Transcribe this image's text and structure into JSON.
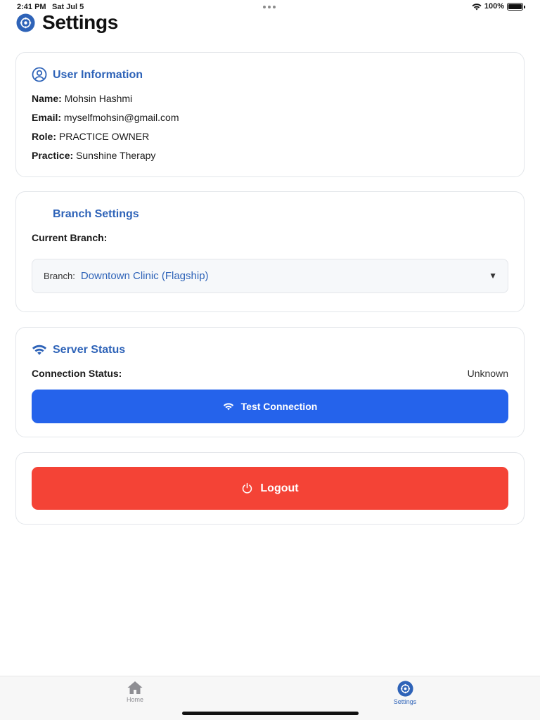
{
  "status_bar": {
    "time": "2:41 PM",
    "date": "Sat Jul 5",
    "battery": "100%",
    "icons": [
      "wifi-icon",
      "battery-icon"
    ]
  },
  "header": {
    "title": "Settings",
    "icon": "settings-icon"
  },
  "user_info": {
    "title": "User Information",
    "icon": "user-circle-icon",
    "fields": [
      {
        "label": "Name:",
        "value": "Mohsin Hashmi"
      },
      {
        "label": "Email:",
        "value": "myselfmohsin@gmail.com"
      },
      {
        "label": "Role:",
        "value": "PRACTICE OWNER"
      },
      {
        "label": "Practice:",
        "value": "Sunshine Therapy"
      }
    ]
  },
  "branch_settings": {
    "title": "Branch Settings",
    "current_label": "Current Branch:",
    "select": {
      "label": "Branch:",
      "value": "Downtown Clinic (Flagship)",
      "caret": "▼"
    }
  },
  "server_status": {
    "title": "Server Status",
    "icon": "wifi-icon",
    "connection_label": "Connection Status:",
    "connection_value": "Unknown",
    "test_button": "Test Connection"
  },
  "logout": {
    "button": "Logout",
    "icon": "power-icon"
  },
  "tab_bar": {
    "tabs": [
      {
        "label": "Home",
        "icon": "home-icon",
        "active": false
      },
      {
        "label": "Settings",
        "icon": "settings-icon",
        "active": true
      }
    ]
  },
  "colors": {
    "accent": "#2e63b8",
    "primary_button": "#2563eb",
    "danger_button": "#f44336",
    "card_border": "#e3e6ea"
  }
}
